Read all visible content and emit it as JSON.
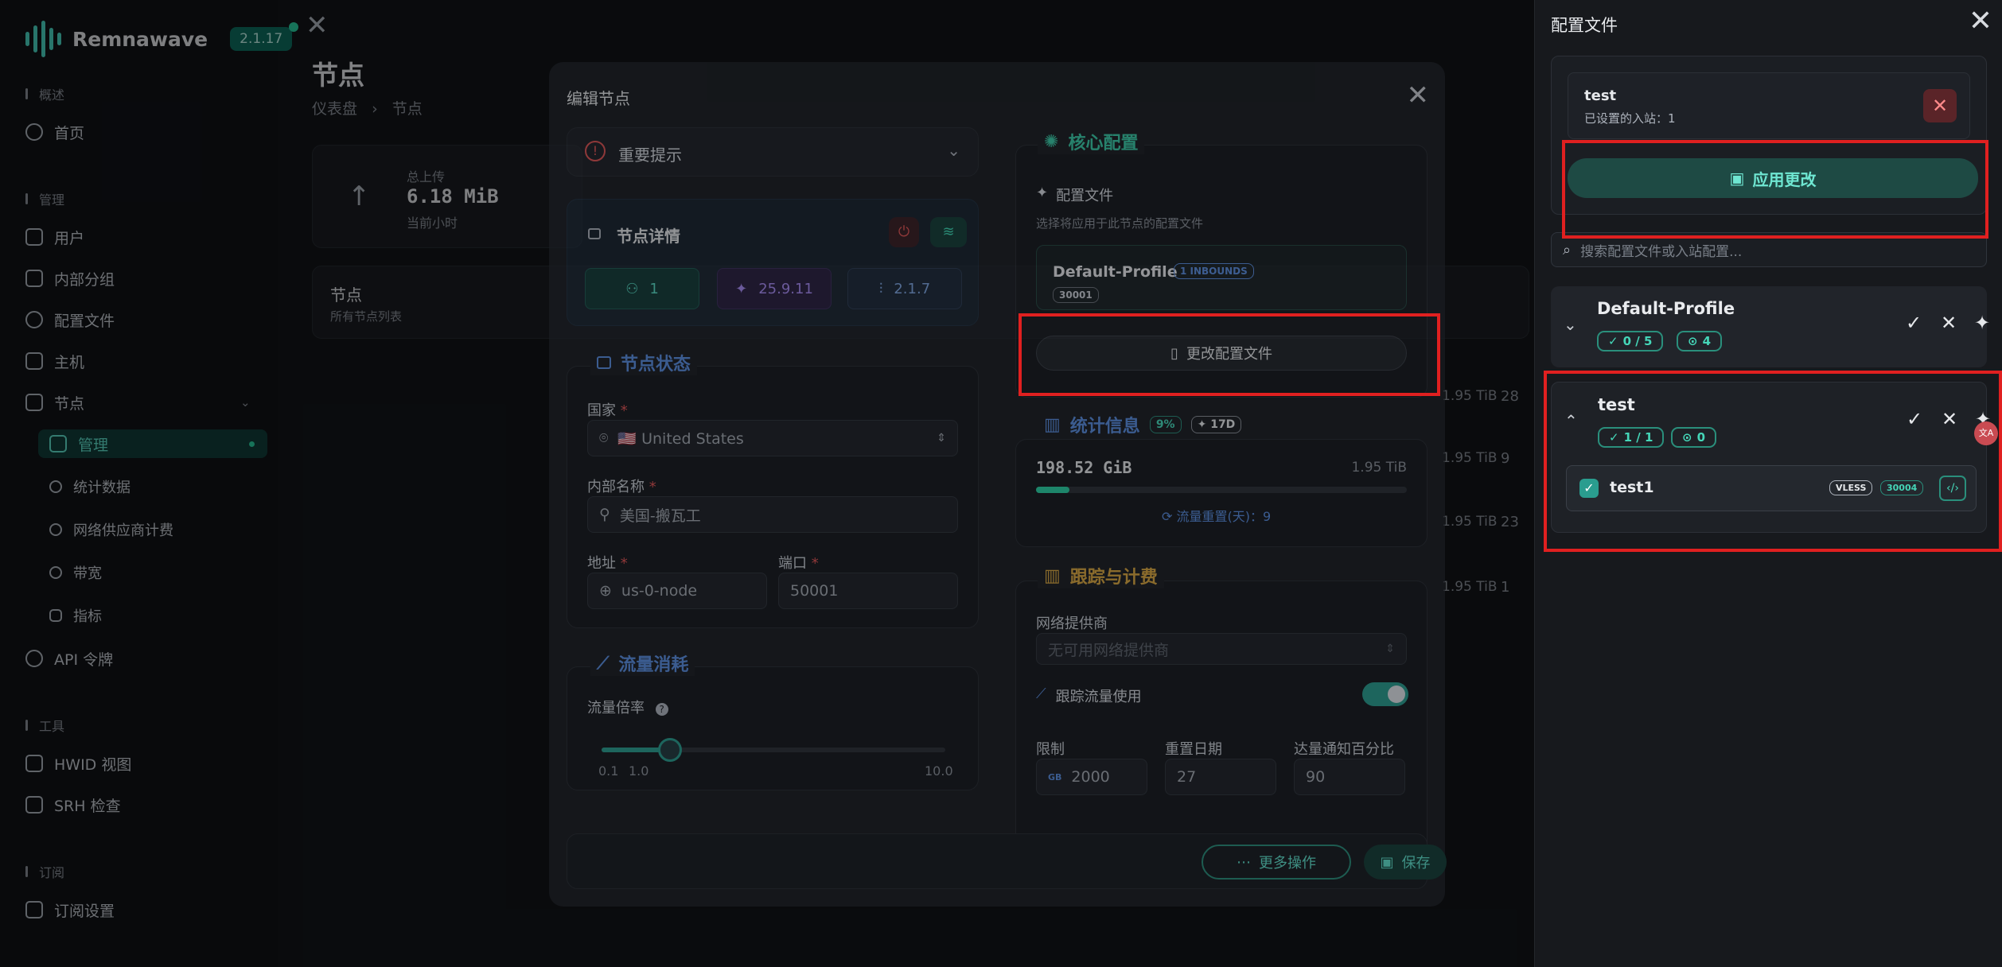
{
  "app": {
    "brand": "Remnawave",
    "version": "2.1.17",
    "page_title": "节点",
    "breadcrumb": [
      "仪表盘",
      "节点"
    ],
    "sections": [
      "概述",
      "管理",
      "工具",
      "订阅"
    ],
    "nav": {
      "home": "首页",
      "users": "用户",
      "internal_squads": "内部分组",
      "config_profiles": "配置文件",
      "hosts": "主机",
      "nodes": "节点",
      "manage": "管理",
      "stats": "统计数据",
      "isp_billing": "网络供应商计费",
      "bandwidth": "带宽",
      "metrics": "指标",
      "api_tokens": "API 令牌",
      "hwid": "HWID 视图",
      "srh": "SRH 检查",
      "sub_settings": "订阅设置"
    },
    "stat_card": {
      "label": "总上传",
      "value": "6.18 MiB",
      "sub": "当前小时"
    },
    "nodes_card": {
      "title": "节点",
      "subtitle": "所有节点列表"
    },
    "bg_rows": [
      "28",
      "9",
      "23",
      "1"
    ],
    "bg_tib": [
      "1.95 TiB",
      "1.95 TiB",
      "1.95 TiB",
      "1.95 TiB"
    ]
  },
  "modal": {
    "title": "编辑节点",
    "important_tip": "重要提示",
    "details": {
      "title": "节点详情",
      "users": "1",
      "xray": "25.9.11",
      "node_version": "2.1.7"
    },
    "status": {
      "title": "节点状态",
      "country_label": "国家",
      "country_value": "🇺🇸 United States",
      "internal_name_label": "内部名称",
      "internal_name_value": "美国-搬瓦工",
      "address_label": "地址",
      "address_value": "us-0-node",
      "port_label": "端口",
      "port_value": "50001"
    },
    "traffic": {
      "title": "流量消耗",
      "rate_label": "流量倍率",
      "min": "0.1",
      "mid": "1.0",
      "max": "10.0",
      "value_fraction": 0.2
    },
    "core": {
      "title": "核心配置",
      "profile_label": "配置文件",
      "profile_hint": "选择将应用于此节点的配置文件",
      "profile_name": "Default-Profile",
      "inbounds_badge": "1 INBOUNDS",
      "port_badge": "30001",
      "change_button": "更改配置文件"
    },
    "stats": {
      "title": "统计信息",
      "pct_badge": "9%",
      "days_badge": "17D",
      "used": "198.52 GiB",
      "limit": "1.95 TiB",
      "progress": 0.09,
      "reset_text": "流量重置(天)：9"
    },
    "billing": {
      "title": "跟踪与计费",
      "isp_label": "网络提供商",
      "isp_placeholder": "无可用网络提供商",
      "track_label": "跟踪流量使用",
      "limit_label": "限制",
      "limit_unit": "GB",
      "limit_value": "2000",
      "reset_day_label": "重置日期",
      "reset_day_value": "27",
      "notify_label": "达量通知百分比",
      "notify_value": "90"
    },
    "footer": {
      "more": "更多操作",
      "save": "保存"
    }
  },
  "drawer": {
    "title": "配置文件",
    "selected": {
      "name": "test",
      "sub": "已设置的入站：1"
    },
    "apply_button": "应用更改",
    "search_placeholder": "搜索配置文件或入站配置...",
    "profiles": [
      {
        "name": "Default-Profile",
        "check": "0 / 5",
        "count": "4"
      },
      {
        "name": "test",
        "check": "1 / 1",
        "count": "0"
      }
    ],
    "inbound": {
      "name": "test1",
      "protocol": "VLESS",
      "port": "30004"
    }
  },
  "colors": {
    "accent": "#2ad1a3",
    "highlight": "#e02020",
    "background": "#0b0c0e"
  }
}
